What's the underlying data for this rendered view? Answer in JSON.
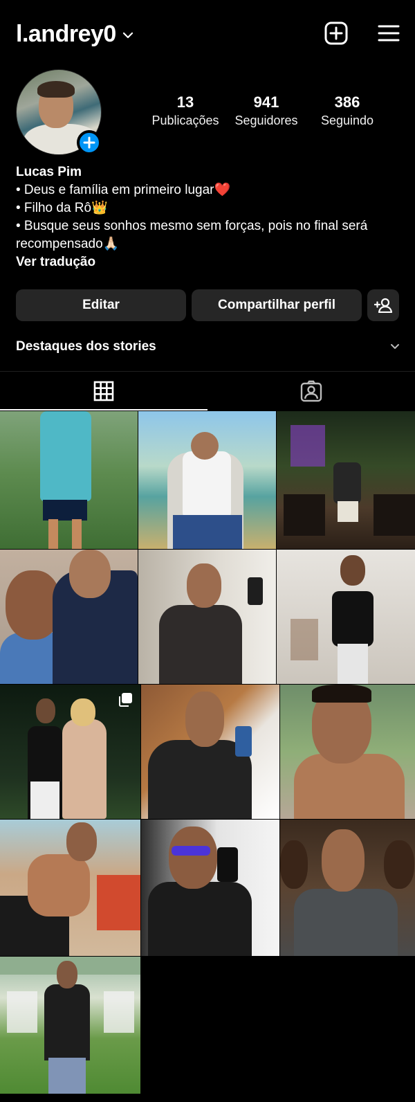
{
  "header": {
    "username": "l.andrey0"
  },
  "profile": {
    "stats": [
      {
        "value": "13",
        "label": "Publicações"
      },
      {
        "value": "941",
        "label": "Seguidores"
      },
      {
        "value": "386",
        "label": "Seguindo"
      }
    ]
  },
  "bio": {
    "name": "Lucas Pim",
    "lines": [
      "• Deus e família em primeiro lugar❤️",
      "• Filho da Rô👑",
      "• Busque seus sonhos mesmo sem forças, pois no final será recompensado🙏🏻"
    ],
    "translate": "Ver tradução"
  },
  "actions": {
    "edit": "Editar",
    "share": "Compartilhar perfil"
  },
  "highlights": {
    "label": "Destaques dos stories"
  },
  "colors": {
    "accent": "#0095f6",
    "background": "#000000",
    "button": "#262626"
  },
  "icons": {
    "header": [
      "chevron-down-icon",
      "new-post-icon",
      "menu-icon"
    ],
    "tabs": [
      "grid-icon",
      "tagged-icon"
    ],
    "other": [
      "add-story-icon",
      "add-person-icon",
      "chevron-down-icon",
      "multi-photo-icon"
    ]
  },
  "grid": {
    "posts": [
      {
        "multi": false
      },
      {
        "multi": false
      },
      {
        "multi": false
      },
      {
        "multi": false
      },
      {
        "multi": false
      },
      {
        "multi": true
      },
      {
        "multi": true
      },
      {
        "multi": false
      },
      {
        "multi": false
      },
      {
        "multi": false
      },
      {
        "multi": false
      },
      {
        "multi": false
      },
      {
        "multi": false
      }
    ]
  }
}
